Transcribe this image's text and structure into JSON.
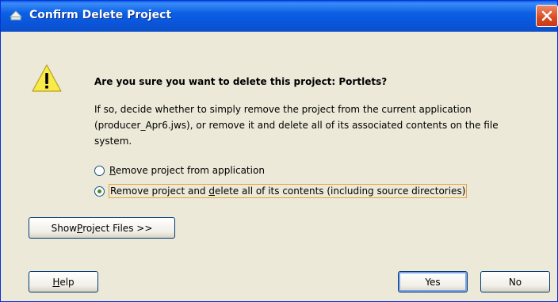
{
  "dialog": {
    "title": "Confirm Delete Project",
    "question": "Are you sure you want to delete this project: Portlets?",
    "message": "If so, decide whether to simply remove the project from the current application (producer_Apr6.jws), or remove it and delete all of its associated contents on the file system.",
    "options": [
      {
        "pre": "",
        "mnemonic": "R",
        "post": "emove project from application",
        "checked": false
      },
      {
        "pre": "Remove project and ",
        "mnemonic": "d",
        "post": "elete all of its contents (including source directories)",
        "checked": true
      }
    ],
    "show_files": {
      "pre": "Show ",
      "mnemonic": "P",
      "post": "roject Files >>"
    },
    "help": {
      "pre": "",
      "mnemonic": "H",
      "post": "elp"
    },
    "yes_label": "Yes",
    "no_label": "No"
  },
  "colors": {
    "titlebar": "#0a5ee8",
    "warning": "#f6e23b",
    "close": "#d84a22"
  }
}
